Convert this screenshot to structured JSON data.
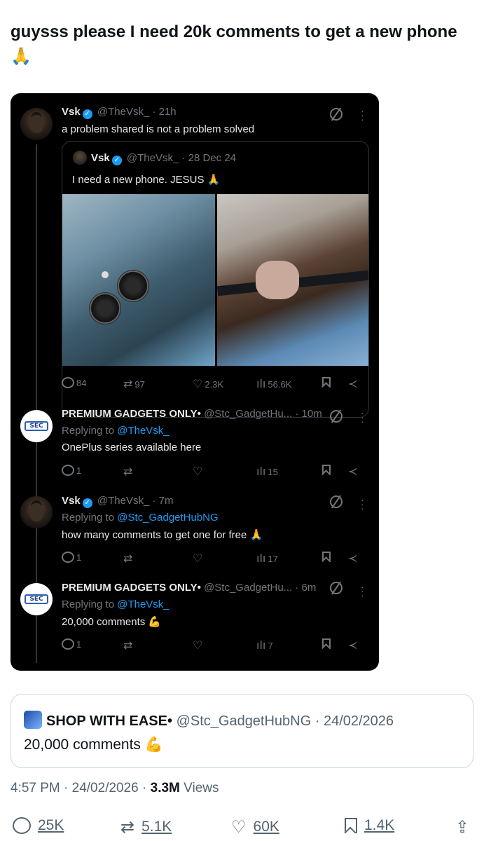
{
  "post": {
    "title": "guysss please I need 20k comments to get a new phone 🙏"
  },
  "screenshot": {
    "tweet1": {
      "name": "Vsk",
      "handle": "@TheVsk_ · 21h",
      "text": "a problem shared is not a problem solved",
      "quote": {
        "name": "Vsk",
        "handle": "@TheVsk_ · 28 Dec 24",
        "text": "I need a new phone. JESUS 🙏"
      },
      "stats": {
        "replies": "84",
        "reposts": "97",
        "likes": "2.3K",
        "views": "56.6K"
      }
    },
    "tweet2": {
      "name": "PREMIUM GADGETS ONLY•",
      "handle": "@Stc_GadgetHu... · 10m",
      "reply_prefix": "Replying to ",
      "reply_to": "@TheVsk_",
      "text": "OnePlus series available here",
      "stats": {
        "replies": "1",
        "views": "15"
      }
    },
    "tweet3": {
      "name": "Vsk",
      "handle": "@TheVsk_ · 7m",
      "reply_prefix": "Replying to ",
      "reply_to": "@Stc_GadgetHubNG",
      "text": "how many comments to get one for free 🙏",
      "stats": {
        "replies": "1",
        "views": "17"
      }
    },
    "tweet4": {
      "name": "PREMIUM GADGETS ONLY•",
      "handle": "@Stc_GadgetHu... · 6m",
      "reply_prefix": "Replying to ",
      "reply_to": "@TheVsk_",
      "text": "20,000 comments 💪",
      "stats": {
        "replies": "1",
        "views": "7"
      }
    },
    "stc_logo_text": "SEC"
  },
  "quoted_card": {
    "name": "SHOP WITH EASE•",
    "handle": "@Stc_GadgetHubNG · 24/02/2026",
    "text": "20,000 comments 💪"
  },
  "meta": {
    "time": "4:57 PM · 24/02/2026 · ",
    "views_count": "3.3M",
    "views_label": " Views"
  },
  "actions": {
    "replies": "25K",
    "reposts": "5.1K",
    "likes": "60K",
    "bookmarks": "1.4K"
  },
  "icons": [
    "verified-icon",
    "hide-reply-icon",
    "more-icon",
    "reply-icon",
    "repost-icon",
    "like-icon",
    "views-icon",
    "bookmark-icon",
    "share-icon"
  ],
  "colors": {
    "link": "#1d9bf0",
    "dark_bg": "#000000",
    "muted": "#71767b"
  }
}
